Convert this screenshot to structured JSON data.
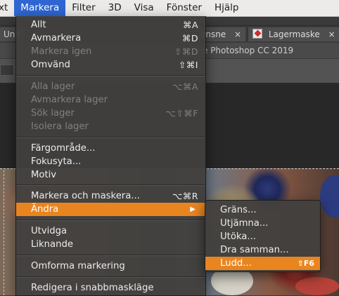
{
  "menubar": {
    "items": [
      {
        "label": "xt"
      },
      {
        "label": "Markera"
      },
      {
        "label": "Filter"
      },
      {
        "label": "3D"
      },
      {
        "label": "Visa"
      },
      {
        "label": "Fönster"
      },
      {
        "label": "Hjälp"
      }
    ]
  },
  "tabs": [
    {
      "label": "Und"
    },
    {
      "label": "onsne"
    },
    {
      "label": "Lagermaske"
    }
  ],
  "tab_close_symbol": "×",
  "window_title": "e Photoshop CC 2019",
  "menu": {
    "items": [
      {
        "label": "Allt",
        "shortcut": "⌘A"
      },
      {
        "label": "Avmarkera",
        "shortcut": "⌘D"
      },
      {
        "label": "Markera igen",
        "shortcut": "⇧⌘D"
      },
      {
        "label": "Omvänd",
        "shortcut": "⇧⌘I"
      },
      {
        "label": "Alla lager",
        "shortcut": "⌥⌘A"
      },
      {
        "label": "Avmarkera lager",
        "shortcut": ""
      },
      {
        "label": "Sök lager",
        "shortcut": "⌥⇧⌘F"
      },
      {
        "label": "Isolera lager",
        "shortcut": ""
      },
      {
        "label": "Färgområde...",
        "shortcut": ""
      },
      {
        "label": "Fokusyta...",
        "shortcut": ""
      },
      {
        "label": "Motiv",
        "shortcut": ""
      },
      {
        "label": "Markera och maskera...",
        "shortcut": "⌥⌘R"
      },
      {
        "label": "Ändra",
        "shortcut": ""
      },
      {
        "label": "Utvidga",
        "shortcut": ""
      },
      {
        "label": "Liknande",
        "shortcut": ""
      },
      {
        "label": "Omforma markering",
        "shortcut": ""
      },
      {
        "label": "Redigera i snabbmaskläge",
        "shortcut": ""
      }
    ]
  },
  "submenu": {
    "items": [
      {
        "label": "Gräns...",
        "shortcut": ""
      },
      {
        "label": "Utjämna...",
        "shortcut": ""
      },
      {
        "label": "Utöka...",
        "shortcut": ""
      },
      {
        "label": "Dra samman...",
        "shortcut": ""
      },
      {
        "label": "Ludd...",
        "shortcut": "⇧F6"
      }
    ]
  },
  "colors": {
    "menu_highlight": "#e8851f",
    "menubar_active": "#2f66d3"
  },
  "icons": {
    "submenu_arrow": "▶"
  }
}
